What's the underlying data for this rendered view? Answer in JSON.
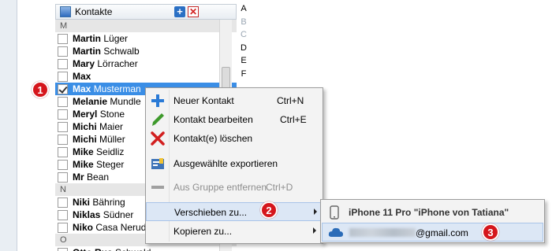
{
  "header": {
    "title": "Kontakte",
    "add_icon": "plus-icon",
    "delete_icon": "x-icon"
  },
  "alphabet": [
    "A",
    "B",
    "C",
    "D",
    "E",
    "F"
  ],
  "list": [
    {
      "type": "group",
      "label": "M"
    },
    {
      "type": "contact",
      "first": "Martin",
      "last": "Lüger",
      "checked": false
    },
    {
      "type": "contact",
      "first": "Martin",
      "last": "Schwalb",
      "checked": false
    },
    {
      "type": "contact",
      "first": "Mary",
      "last": "Lörracher",
      "checked": false
    },
    {
      "type": "contact",
      "first": "Max",
      "last": "",
      "checked": false
    },
    {
      "type": "contact",
      "first": "Max",
      "last": "Musterman",
      "checked": true,
      "selected": true
    },
    {
      "type": "contact",
      "first": "Melanie",
      "last": "Mundle",
      "checked": false
    },
    {
      "type": "contact",
      "first": "Meryl",
      "last": "Stone",
      "checked": false
    },
    {
      "type": "contact",
      "first": "Michi",
      "last": "Maier",
      "checked": false
    },
    {
      "type": "contact",
      "first": "Michi",
      "last": "Müller",
      "checked": false
    },
    {
      "type": "contact",
      "first": "Mike",
      "last": "Seidliz",
      "checked": false
    },
    {
      "type": "contact",
      "first": "Mike",
      "last": "Steger",
      "checked": false
    },
    {
      "type": "contact",
      "first": "Mr",
      "last": "Bean",
      "checked": false
    },
    {
      "type": "group",
      "label": "N"
    },
    {
      "type": "contact",
      "first": "Niki",
      "last": "Bähring",
      "checked": false
    },
    {
      "type": "contact",
      "first": "Niklas",
      "last": "Südner",
      "checked": false
    },
    {
      "type": "contact",
      "first": "Niko",
      "last": "Casa Neruda",
      "checked": false
    },
    {
      "type": "group",
      "label": "O"
    },
    {
      "type": "contact",
      "first": "Otto Rus",
      "last": "Schwald",
      "checked": false
    }
  ],
  "context_menu": [
    {
      "label": "Neuer Kontakt",
      "shortcut": "Ctrl+N",
      "icon": "plus-icon",
      "disabled": false
    },
    {
      "label": "Kontakt bearbeiten",
      "shortcut": "Ctrl+E",
      "icon": "pencil-icon",
      "disabled": false
    },
    {
      "label": "Kontakt(e) löschen",
      "shortcut": "",
      "icon": "x-icon",
      "disabled": false
    },
    {
      "label": "Ausgewählte exportieren",
      "shortcut": "",
      "icon": "export-icon",
      "disabled": false
    },
    {
      "label": "Aus Gruppe entfernen",
      "shortcut": "Ctrl+D",
      "icon": "minus-icon",
      "disabled": true
    },
    {
      "label": "Verschieben zu...",
      "shortcut": "",
      "icon": "",
      "disabled": false,
      "submenu": true,
      "hover": true
    },
    {
      "label": "Kopieren zu...",
      "shortcut": "",
      "icon": "",
      "disabled": false,
      "submenu": true
    }
  ],
  "submenu": [
    {
      "label": "iPhone 11 Pro \"iPhone von Tatiana\"",
      "icon": "phone-icon"
    },
    {
      "label": "@gmail.com",
      "icon": "cloud-icon",
      "hover": true
    }
  ],
  "badges": [
    "1",
    "2",
    "3"
  ],
  "colors": {
    "selection": "#3a8ee6",
    "badge": "#d5161c",
    "menu_hover": "#dce7f5"
  }
}
